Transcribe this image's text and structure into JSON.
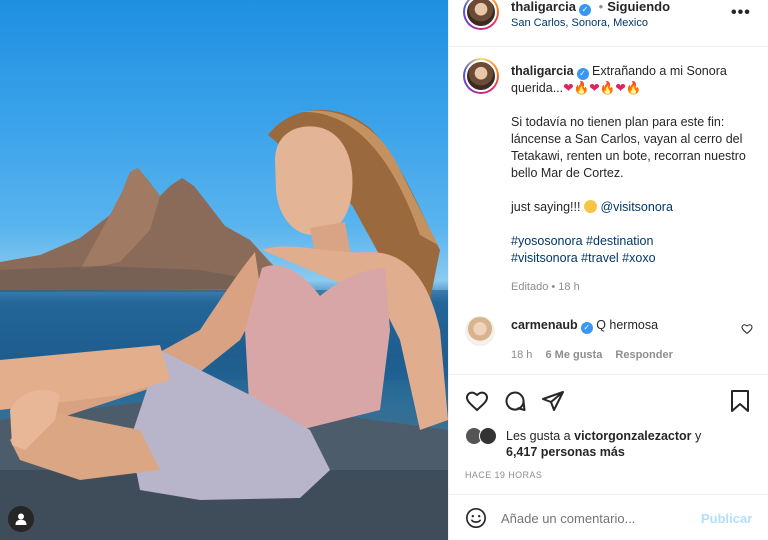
{
  "post": {
    "username": "thaligarcia",
    "follow_status": "Siguiendo",
    "location": "San Carlos, Sonora, Mexico",
    "caption_line1": "Extrañando a mi Sonora querida...",
    "caption_emojis": "❤🔥❤🔥❤🔥",
    "caption_p2": "Si todavía no tienen plan para este fin: láncense a San Carlos, vayan al cerro del Tetakawi, renten un bote, recorran nuestro bello Mar de Cortez.",
    "caption_p3": "just saying!!!",
    "caption_mention": "@visitsonora",
    "hashtags_line1": "#yososonora #destination",
    "hashtags_line2": "#visitsonora #travel #xoxo",
    "edited_label": "Editado",
    "edited_time": "18 h",
    "dot": "•"
  },
  "comment": {
    "username": "carmenaub",
    "text": "Q hermosa",
    "time": "18 h",
    "likes": "6 Me gusta",
    "reply": "Responder"
  },
  "likes": {
    "prefix": "Les gusta a",
    "user": "victorgonzalezactor",
    "and": "y",
    "others": "6,417 personas más"
  },
  "timestamp": "HACE 19 HORAS",
  "comment_input": {
    "placeholder": "Añade un comentario...",
    "publish": "Publicar"
  },
  "icons": {
    "more": "more-icon",
    "like": "heart-icon",
    "comment": "comment-icon",
    "share": "share-icon",
    "save": "bookmark-icon",
    "emoji": "emoji-icon",
    "user_tag": "user-tag-icon",
    "comment_like": "small-heart-icon"
  },
  "colors": {
    "link": "#00376b",
    "verified": "#3897f0",
    "publish": "#b2dffc",
    "muted": "#8e8e8e"
  }
}
